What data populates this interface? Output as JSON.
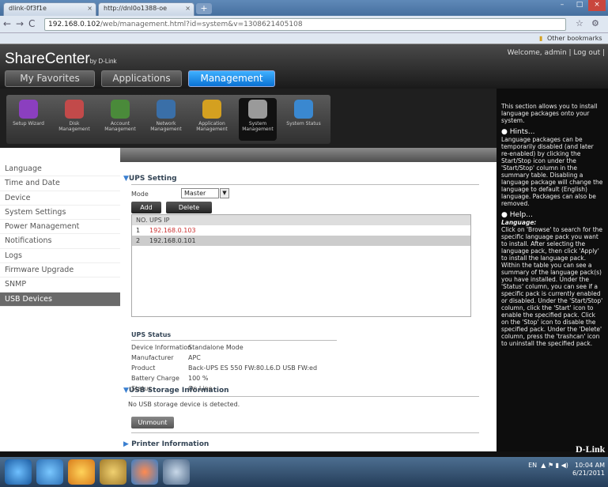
{
  "browser": {
    "tabs": [
      "dlink-0f3f1e",
      "http://dnl0o1388-oe"
    ],
    "url_host": "192.168.0.102",
    "url_path": "/web/management.html?id=system&v=1308621405108",
    "bookmarks": "Other bookmarks"
  },
  "app": {
    "brand": "ShareCenter",
    "brand_sub": "by D-Link",
    "welcome": "Welcome, admin | Log out |",
    "nav": [
      "My Favorites",
      "Applications",
      "Management"
    ],
    "active_nav": "Management"
  },
  "iconbar": [
    {
      "label": "Setup Wizard",
      "icon": "wizard-icon",
      "color": "#8b3fbf"
    },
    {
      "label": "Disk Management",
      "icon": "disk-icon",
      "color": "#c24a4a"
    },
    {
      "label": "Account Management",
      "icon": "account-icon",
      "color": "#4a8a3a"
    },
    {
      "label": "Network Management",
      "icon": "network-icon",
      "color": "#3a6fa8"
    },
    {
      "label": "Application Management",
      "icon": "application-icon",
      "color": "#d4a020"
    },
    {
      "label": "System Management",
      "icon": "gear-icon",
      "color": "#9a9a9a"
    },
    {
      "label": "System Status",
      "icon": "info-icon",
      "color": "#3a88d0"
    }
  ],
  "panel_title": "System Management",
  "menu": [
    "Language",
    "Time and Date",
    "Device",
    "System Settings",
    "Power Management",
    "Notifications",
    "Logs",
    "Firmware Upgrade",
    "SNMP",
    "USB Devices"
  ],
  "active_menu": "USB Devices",
  "ups": {
    "title": "UPS Setting",
    "mode_label": "Mode",
    "mode_value": "Master",
    "add": "Add",
    "delete": "Delete",
    "table_head": [
      "NO.",
      "UPS IP"
    ],
    "rows": [
      {
        "no": "1",
        "ip": "192.168.0.103"
      },
      {
        "no": "2",
        "ip": "192.168.0.101"
      }
    ]
  },
  "ups_status": {
    "title": "UPS Status",
    "fields": [
      {
        "k": "Device Information",
        "v": "Standalone Mode"
      },
      {
        "k": "Manufacturer",
        "v": "APC"
      },
      {
        "k": "Product",
        "v": "Back-UPS ES 550 FW:80.L6.D USB FW:ed"
      },
      {
        "k": "Battery Charge",
        "v": "100 %"
      },
      {
        "k": "Status",
        "v": "On Line"
      }
    ]
  },
  "usb": {
    "title": "USB Storage Information",
    "message": "No USB storage device is detected.",
    "unmount": "Unmount"
  },
  "printer_title": "Printer Information",
  "help": {
    "intro": "This section allows you to install language packages onto your system.",
    "hints_title": "Hints...",
    "hints": "Language packages can be temporarily disabled (and later re-enabled) by clicking the Start/Stop icon under the 'Start/Stop' column in the summary table. Disabling a language package will change the language to default (English) language. Packages can also be removed.",
    "help_title": "Help...",
    "help_sub": "Language:",
    "help_text": "Click on 'Browse' to search for the specific language pack you want to install. After selecting the language pack, then click 'Apply' to install the language pack. Within the table you can see a summary of the language pack(s) you have installed. Under the 'Status' column, you can see if a specific pack is currently enabled or disabled. Under the 'Start/Stop' column, click the 'Start' icon to enable the specified pack. Click on the 'Stop' icon to disable the specified pack. Under the 'Delete' column, press the 'trashcan' icon to uninstall the specified pack.",
    "brand": "D-Link"
  },
  "taskbar": {
    "lang": "EN",
    "time": "10:04 AM",
    "date": "6/21/2011"
  }
}
